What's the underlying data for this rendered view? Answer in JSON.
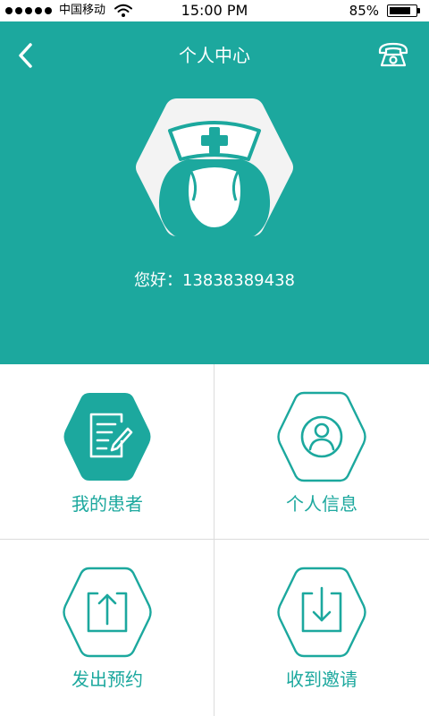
{
  "status_bar": {
    "carrier": "中国移动",
    "time": "15:00 PM",
    "battery": "85%",
    "battery_level": 0.85
  },
  "header": {
    "title": "个人中心",
    "back_icon": "chevron-left-icon",
    "phone_icon": "telephone-icon"
  },
  "profile": {
    "avatar_icon": "nurse-avatar-icon",
    "greeting": "您好：13838389438"
  },
  "menu": [
    {
      "label": "我的患者",
      "icon": "document-edit-icon",
      "filled": true
    },
    {
      "label": "个人信息",
      "icon": "user-profile-icon",
      "filled": false
    },
    {
      "label": "发出预约",
      "icon": "upload-icon",
      "filled": false
    },
    {
      "label": "收到邀请",
      "icon": "download-icon",
      "filled": false
    }
  ],
  "colors": {
    "accent": "#1ca89e",
    "divider": "#dcdcdc",
    "background": "#ffffff",
    "avatar_bg": "#f3f3f3"
  }
}
